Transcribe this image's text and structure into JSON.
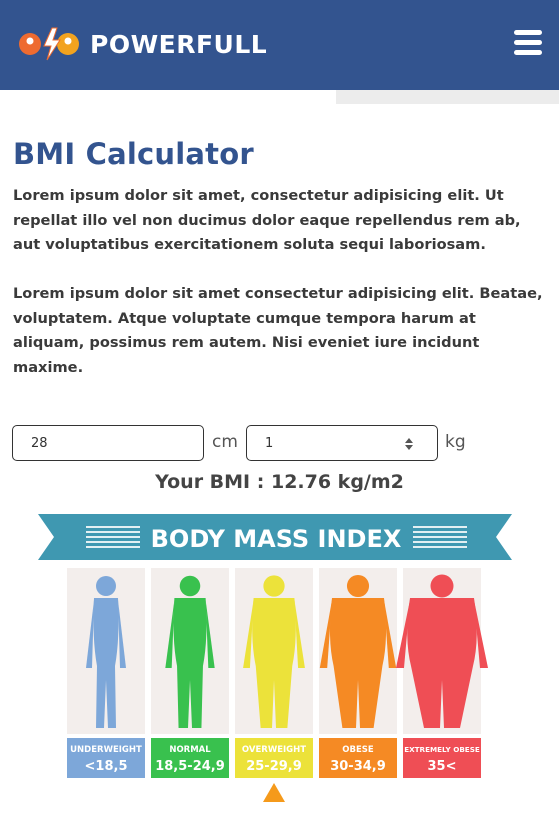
{
  "brand": {
    "name": "POWERFULL",
    "icon": "powerfull-logo-icon"
  },
  "menu": {
    "icon": "hamburger-menu-icon"
  },
  "page": {
    "title": "BMI Calculator",
    "paragraph1": "Lorem ipsum dolor sit amet, consectetur adipisicing elit. Ut repellat illo vel non ducimus dolor eaque repellendus rem ab, aut voluptatibus exercitationem soluta sequi laboriosam.",
    "paragraph2": "Lorem ipsum dolor sit amet consectetur adipisicing elit. Beatae, voluptatem. Atque voluptate cumque tempora harum at aliquam, possimus rem autem. Nisi eveniet iure incidunt maxime."
  },
  "form": {
    "height_value": "28",
    "height_unit": "cm",
    "weight_value": "1",
    "weight_unit": "kg"
  },
  "result": {
    "label": "Your BMI :",
    "value": "12.76 kg/m2"
  },
  "bmi_chart": {
    "banner": "BODY MASS INDEX",
    "categories": [
      {
        "name": "UNDERWEIGHT",
        "range": "<18,5",
        "color": "#7da7d9",
        "bg": "#f3eeec",
        "scale": 0.0
      },
      {
        "name": "NORMAL",
        "range": "18,5-24,9",
        "color": "#39c14e",
        "bg": "#f3eeec",
        "scale": 0.18
      },
      {
        "name": "OVERWEIGHT",
        "range": "25-29,9",
        "color": "#ece23a",
        "bg": "#f3eeec",
        "scale": 0.42
      },
      {
        "name": "OBESE",
        "range": "30-34,9",
        "color": "#f58a24",
        "bg": "#f3eeec",
        "scale": 0.7
      },
      {
        "name": "EXTREMELY OBESE",
        "range": "35<",
        "color": "#ef4e55",
        "bg": "#f3eeec",
        "scale": 1.0
      }
    ],
    "indicator_index": 2,
    "indicator_color": "#f59a1b",
    "banner_color": "#3f98b1"
  }
}
